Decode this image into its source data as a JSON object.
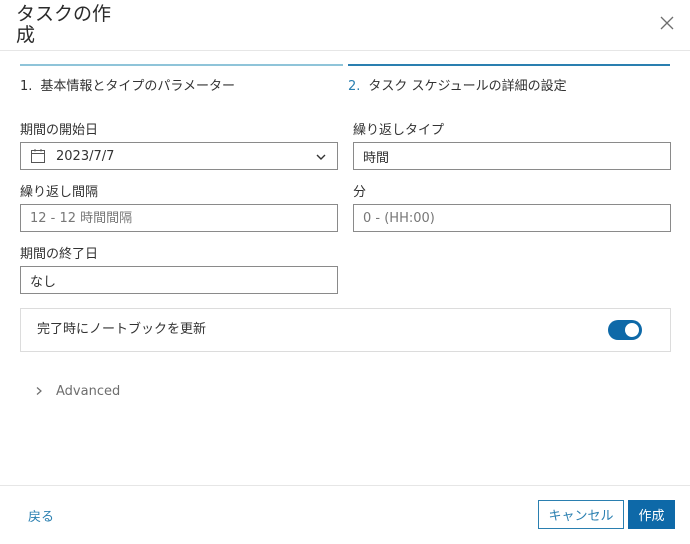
{
  "dialog": {
    "title": "タスクの作成",
    "close_icon": "close-icon"
  },
  "steps": [
    {
      "number": "1.",
      "label": "基本情報とタイプのパラメーター",
      "state": "completed"
    },
    {
      "number": "2.",
      "label": "タスク スケジュールの詳細の設定",
      "state": "active"
    }
  ],
  "form": {
    "start_date": {
      "label": "期間の開始日",
      "value": "2023/7/7",
      "icon": "calendar-icon"
    },
    "repeat_type": {
      "label": "繰り返しタイプ",
      "value": "時間"
    },
    "repeat_interval": {
      "label": "繰り返し間隔",
      "placeholder": "12 - 12 時間間隔"
    },
    "minutes": {
      "label": "分",
      "placeholder": "0 - (HH:00)"
    },
    "end_date": {
      "label": "期間の終了日",
      "value": "なし"
    }
  },
  "toggle": {
    "label": "完了時にノートブックを更新",
    "on": true
  },
  "advanced": {
    "label": "Advanced",
    "icon": "chevron-right-icon"
  },
  "footer": {
    "back_label": "戻る",
    "cancel_label": "キャンセル",
    "create_label": "作成"
  },
  "colors": {
    "accent": "#0e69a8",
    "link": "#2a7fb0",
    "step_completed_bar": "#8fc4d9",
    "step_active_bar": "#2a7fb0"
  }
}
